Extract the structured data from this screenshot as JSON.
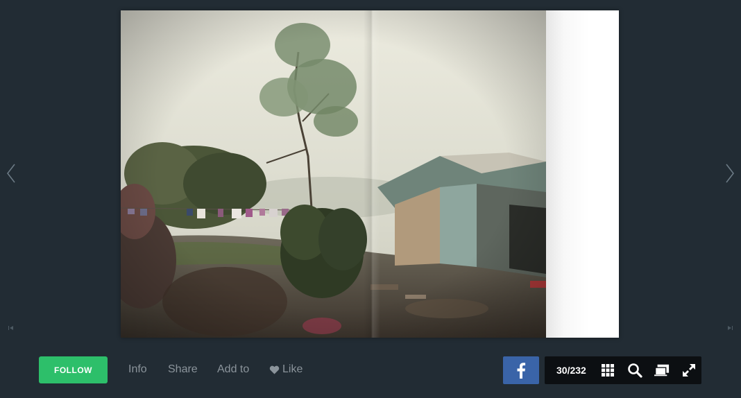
{
  "viewer": {
    "prev_icon": "chevron-left-icon",
    "next_icon": "chevron-right-icon",
    "first_icon": "skip-first-icon",
    "last_icon": "skip-last-icon"
  },
  "toolbar": {
    "follow_label": "FOLLOW",
    "info_label": "Info",
    "share_label": "Share",
    "add_to_label": "Add to",
    "like_label": "Like",
    "like_icon": "heart-icon",
    "facebook_icon": "facebook-icon",
    "page_counter": "30/232",
    "grid_icon": "grid-icon",
    "search_icon": "search-icon",
    "view_mode_icon": "view-mode-icon",
    "fullscreen_icon": "fullscreen-icon"
  },
  "colors": {
    "background": "#222c34",
    "follow_green": "#2dbf6a",
    "facebook_blue": "#3a64a8",
    "controls_bg": "#0c0f12"
  }
}
